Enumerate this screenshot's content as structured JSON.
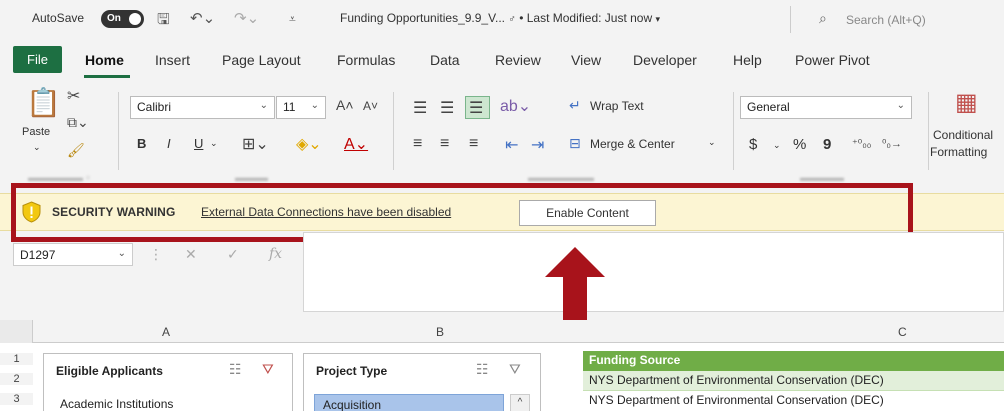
{
  "title_bar": {
    "autosave_label": "AutoSave",
    "autosave_state": "On",
    "document_title": "Funding Opportunities_9.9_V...",
    "last_modified": "• Last Modified: Just now",
    "search_placeholder": "Search (Alt+Q)"
  },
  "ribbon_tabs": {
    "file": "File",
    "items": [
      "Home",
      "Insert",
      "Page Layout",
      "Formulas",
      "Data",
      "Review",
      "View",
      "Developer",
      "Help",
      "Power Pivot"
    ],
    "active": "Home"
  },
  "ribbon": {
    "paste_label": "Paste",
    "font_name": "Calibri",
    "font_size": "11",
    "bold": "B",
    "italic": "I",
    "underline": "U",
    "wrap_text": "Wrap Text",
    "merge_center": "Merge & Center",
    "number_format": "General",
    "currency": "$",
    "percent": "%",
    "comma": "9",
    "conditional_formatting_1": "Conditional",
    "conditional_formatting_2": "Formatting"
  },
  "security_warning": {
    "title": "SECURITY WARNING",
    "message": "External Data Connections have been disabled",
    "button_label": "Enable Content"
  },
  "formula_bar": {
    "name_box": "D1297",
    "fx": "fx",
    "formula": ""
  },
  "grid": {
    "columns": [
      "A",
      "B",
      "C"
    ],
    "rows": [
      "1",
      "2",
      "3"
    ]
  },
  "slicers": {
    "eligible_applicants": {
      "title": "Eligible Applicants",
      "items": [
        "Academic Institutions"
      ]
    },
    "project_type": {
      "title": "Project Type",
      "items": [
        "Acquisition"
      ]
    }
  },
  "column_c": {
    "header": "Funding Source",
    "values": [
      "NYS Department of Environmental Conservation (DEC)",
      "NYS Department of Environmental Conservation (DEC)"
    ]
  },
  "colors": {
    "excel_green": "#1d6f42",
    "warning_bg": "#fcf5d3",
    "highlight_red": "#a8131b",
    "table_header_green": "#70ad47",
    "table_band": "#e2efda",
    "slicer_selected": "#a9c4ea"
  }
}
